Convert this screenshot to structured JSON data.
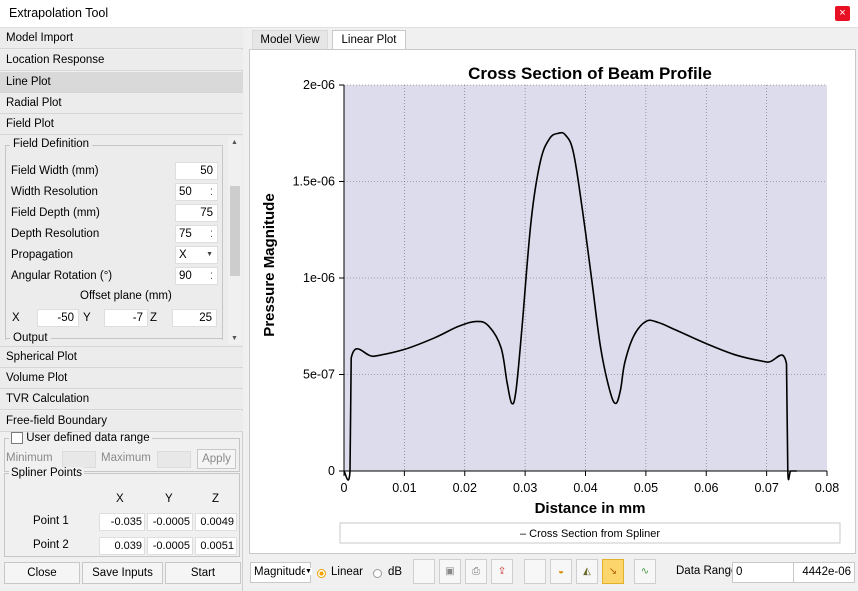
{
  "window": {
    "title": "Extrapolation Tool",
    "close_label": "×"
  },
  "sections": [
    "Model Import",
    "Location Response",
    "Line Plot",
    "Radial Plot",
    "Field Plot"
  ],
  "sections_after": [
    "Spherical Plot",
    "Volume Plot",
    "TVR Calculation",
    "Free-field Boundary"
  ],
  "field_definition": {
    "legend": "Field Definition",
    "field_width_label": "Field Width (mm)",
    "field_width_value": "50",
    "width_resolution_label": "Width Resolution",
    "width_resolution_value": "50",
    "field_depth_label": "Field Depth (mm)",
    "field_depth_value": "75",
    "depth_resolution_label": "Depth Resolution",
    "depth_resolution_value": "75",
    "propagation_label": "Propagation",
    "propagation_value": "X",
    "angular_rotation_label": "Angular Rotation (°)",
    "angular_rotation_value": "90",
    "offset_label": "Offset plane (mm)",
    "x_label": "X",
    "x_value": "-50",
    "y_label": "Y",
    "y_value": "-7",
    "z_label": "Z",
    "z_value": "25",
    "output_label": "Output"
  },
  "user_range": {
    "checkbox_label": "User defined data range",
    "min_label": "Minimum",
    "max_label": "Maximum",
    "apply_label": "Apply"
  },
  "spliner": {
    "legend": "Spliner Points",
    "col_x": "X",
    "col_y": "Y",
    "col_z": "Z",
    "p1_label": "Point 1",
    "p1_x": "-0.035",
    "p1_y": "-0.0005",
    "p1_z": "0.0049",
    "p2_label": "Point 2",
    "p2_x": "0.039",
    "p2_y": "-0.0005",
    "p2_z": "0.0051"
  },
  "buttons": {
    "close": "Close",
    "save_inputs": "Save Inputs",
    "start": "Start"
  },
  "tabs": {
    "model_view": "Model View",
    "linear_plot": "Linear Plot"
  },
  "toolbar": {
    "magnitude": "Magnitude",
    "linear": "Linear",
    "db": "dB",
    "data_range_label": "Data Range",
    "data_range_min": "0",
    "data_range_max": "4442e-06",
    "accent_color": "#fcd56c"
  },
  "chart_data": {
    "type": "line",
    "title": "Cross Section of Beam Profile",
    "xlabel": "Distance in mm",
    "ylabel": "Pressure Magnitude",
    "xlim": [
      0,
      0.08
    ],
    "ylim": [
      0,
      2e-06
    ],
    "x_ticks": [
      "0",
      "0.01",
      "0.02",
      "0.03",
      "0.04",
      "0.05",
      "0.06",
      "0.07",
      "0.08"
    ],
    "y_ticks": [
      "0",
      "5e-07",
      "1e-06",
      "1.5e-06",
      "2e-06"
    ],
    "grid": true,
    "legend": [
      "Cross Section from Spliner"
    ],
    "legend_position": "bottom",
    "plot_background": "#dcdcec",
    "series": [
      {
        "name": "Cross Section from Spliner",
        "x": [
          0,
          0.001,
          0.0012,
          0.005,
          0.01,
          0.015,
          0.019,
          0.022,
          0.024,
          0.026,
          0.027,
          0.0278,
          0.0285,
          0.0295,
          0.031,
          0.0325,
          0.034,
          0.0355,
          0.0367,
          0.038,
          0.0395,
          0.041,
          0.0425,
          0.044,
          0.045,
          0.0458,
          0.0465,
          0.048,
          0.05,
          0.052,
          0.055,
          0.06,
          0.065,
          0.07,
          0.0733,
          0.0735,
          0.074,
          0.075
        ],
        "y": [
          0,
          0,
          5.85e-07,
          5.95e-07,
          6.3e-07,
          6.9e-07,
          7.5e-07,
          7.75e-07,
          7.5e-07,
          6.4e-07,
          4.6e-07,
          3.5e-07,
          4.2e-07,
          7.5e-07,
          1.3e-06,
          1.6e-06,
          1.72e-06,
          1.75e-06,
          1.74e-06,
          1.65e-06,
          1.35e-06,
          1e-06,
          6.4e-07,
          4.2e-07,
          3.5e-07,
          4.2e-07,
          5.6e-07,
          7e-07,
          7.75e-07,
          7.7e-07,
          7.3e-07,
          6.6e-07,
          6e-07,
          5.65e-07,
          5.55e-07,
          0,
          0,
          0
        ]
      }
    ]
  }
}
